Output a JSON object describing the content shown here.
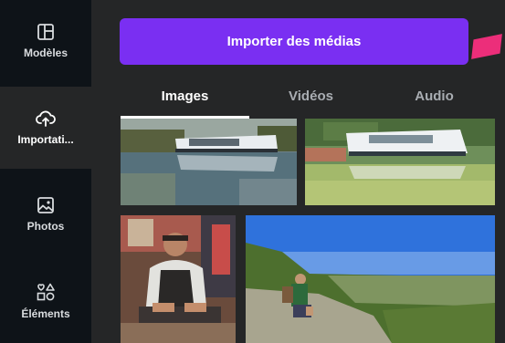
{
  "sidebar": {
    "items": [
      {
        "label": "Modèles",
        "icon": "templates-icon"
      },
      {
        "label": "Importati...",
        "icon": "upload-cloud-icon",
        "active": true
      },
      {
        "label": "Photos",
        "icon": "image-icon"
      },
      {
        "label": "Éléments",
        "icon": "elements-icon"
      }
    ]
  },
  "panel": {
    "upload_button_label": "Importer des médias",
    "tabs": [
      {
        "label": "Images",
        "active": true
      },
      {
        "label": "Vidéos"
      },
      {
        "label": "Audio"
      }
    ]
  },
  "colors": {
    "rail_bg": "#0e1318",
    "panel_bg": "#252627",
    "accent_purple": "#7a2ff2",
    "pink_mark": "#ec2e7a"
  }
}
